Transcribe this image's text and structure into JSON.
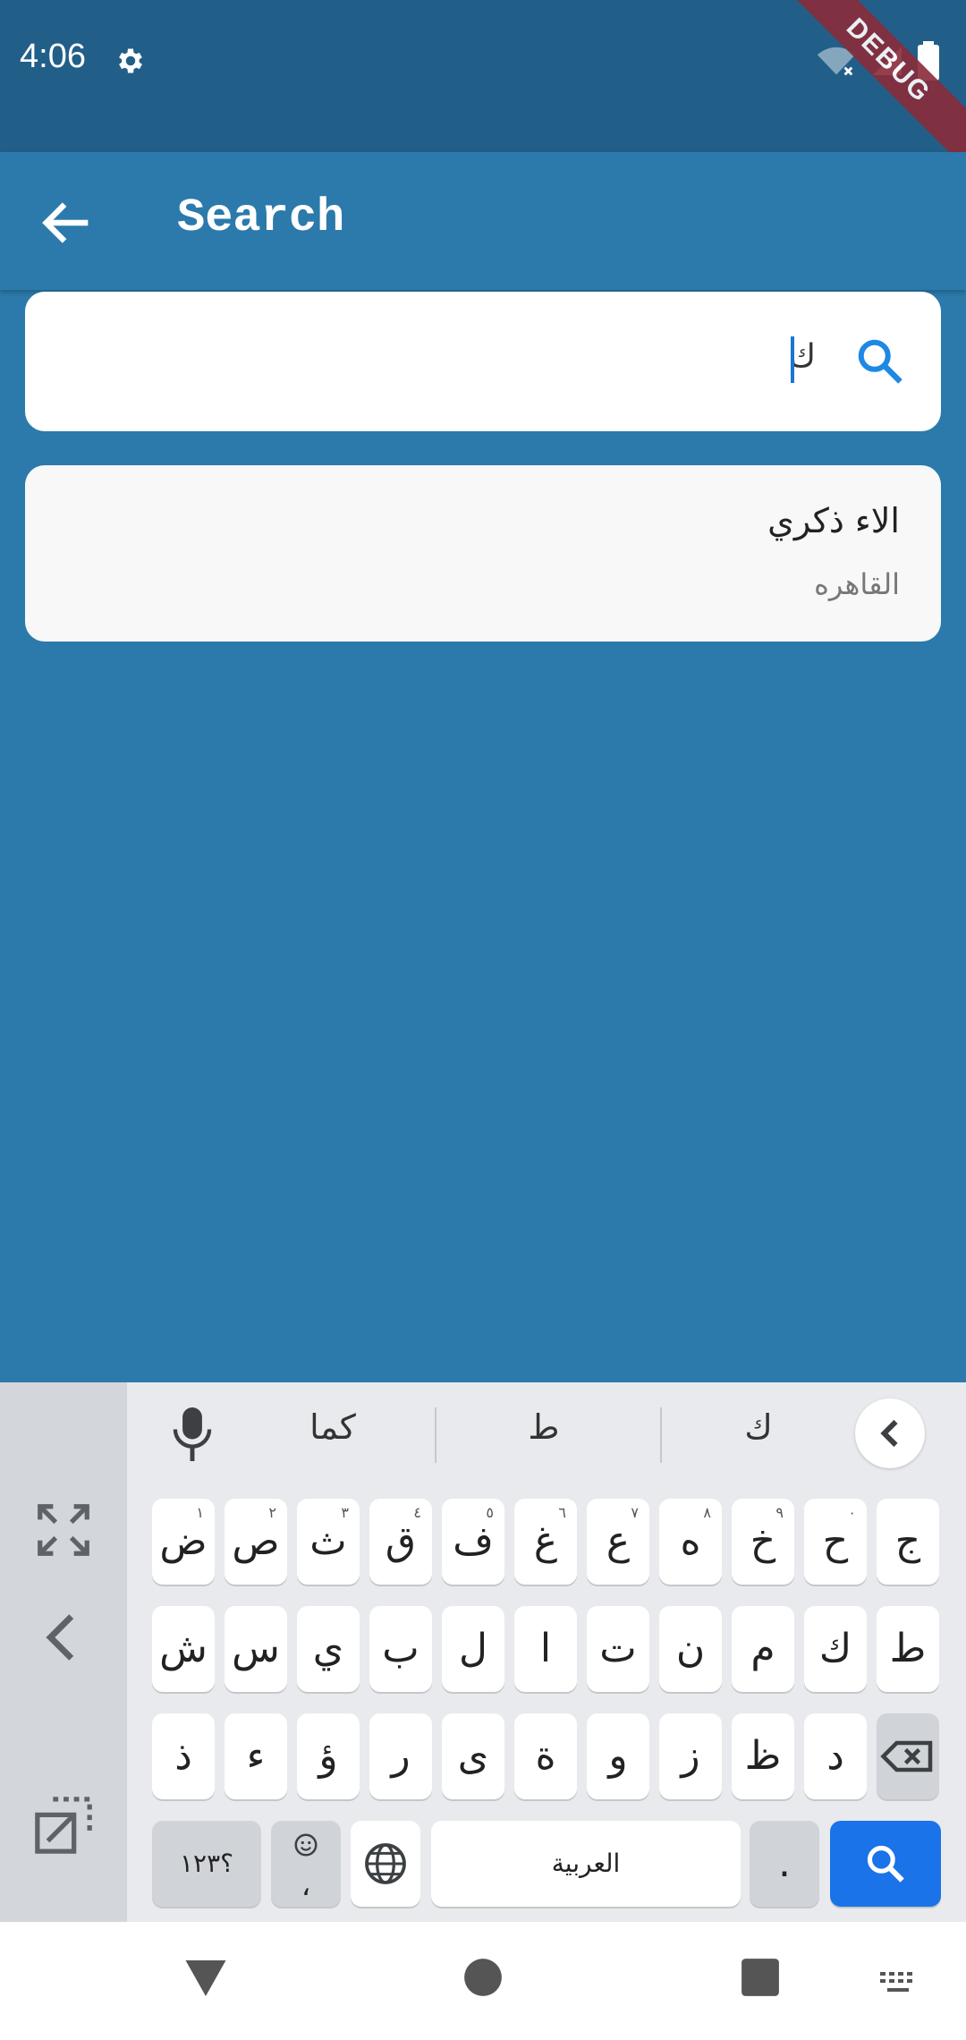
{
  "status_bar": {
    "time": "4:06",
    "debug": "DEBUG"
  },
  "app_bar": {
    "title": "Search"
  },
  "search": {
    "value": "ك",
    "placeholder": ""
  },
  "results": [
    {
      "name": "الاء  ذكري",
      "city": "القاهره"
    }
  ],
  "keyboard": {
    "suggestions": [
      "كما",
      "ط",
      "ك"
    ],
    "row1": [
      "ض",
      "ص",
      "ث",
      "ق",
      "ف",
      "غ",
      "ع",
      "ه",
      "خ",
      "ح",
      "ج"
    ],
    "row1_hints": [
      "١",
      "٢",
      "٣",
      "٤",
      "٥",
      "٦",
      "٧",
      "٨",
      "٩",
      "٠",
      ""
    ],
    "row2": [
      "ش",
      "س",
      "ي",
      "ب",
      "ل",
      "ا",
      "ت",
      "ن",
      "م",
      "ك",
      "ط"
    ],
    "row3": [
      "ذ",
      "ء",
      "ؤ",
      "ر",
      "ى",
      "ة",
      "و",
      "ز",
      "ظ",
      "د"
    ],
    "symbols_label": "؟١٢٣",
    "emoji_comma": "،",
    "space_label": "العربية",
    "period_label": "."
  },
  "colors": {
    "status_bar": "#215f89",
    "app_bar": "#2b7aab",
    "accent": "#1a73e8",
    "search_icon": "#1e88e5"
  }
}
